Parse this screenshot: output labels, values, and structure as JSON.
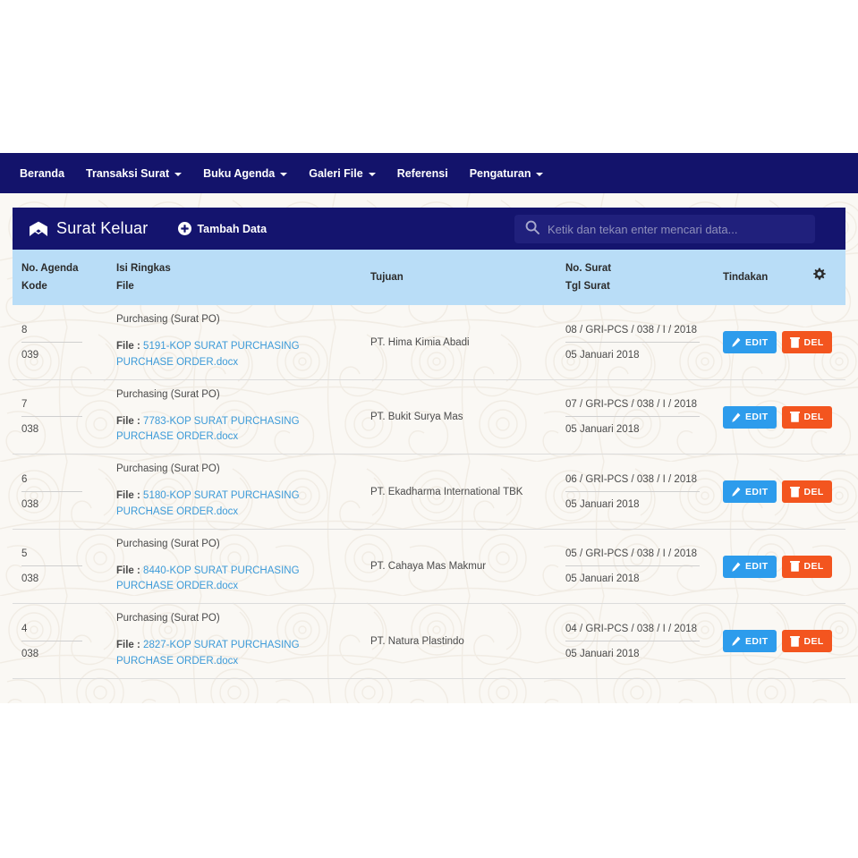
{
  "navbar": {
    "items": [
      {
        "label": "Beranda",
        "caret": false,
        "name": "nav-beranda"
      },
      {
        "label": "Transaksi Surat",
        "caret": true,
        "name": "nav-transaksi-surat"
      },
      {
        "label": "Buku Agenda",
        "caret": true,
        "name": "nav-buku-agenda"
      },
      {
        "label": "Galeri File",
        "caret": true,
        "name": "nav-galeri-file"
      },
      {
        "label": "Referensi",
        "caret": false,
        "name": "nav-referensi"
      },
      {
        "label": "Pengaturan",
        "caret": true,
        "name": "nav-pengaturan"
      }
    ]
  },
  "panel": {
    "title": "Surat Keluar",
    "title_icon": "envelope-icon",
    "add_label": "Tambah Data",
    "add_icon": "plus-circle-icon",
    "search": {
      "icon": "search-icon",
      "placeholder": "Ketik dan tekan enter mencari data...",
      "value": ""
    }
  },
  "table": {
    "headers": {
      "agenda_line1": "No. Agenda",
      "agenda_line2": "Kode",
      "isi_line1": "Isi Ringkas",
      "isi_line2": "File",
      "tujuan": "Tujuan",
      "surat_line1": "No. Surat",
      "surat_line2": "Tgl Surat",
      "tindakan": "Tindakan",
      "gear_icon": "gear-icon"
    },
    "file_label": "File :",
    "actions": {
      "edit": "EDIT",
      "del": "DEL"
    },
    "rows": [
      {
        "no_agenda": "8",
        "kode": "039",
        "isi_ringkas": "Purchasing (Surat PO)",
        "file_name": "5191-KOP SURAT PURCHASING PURCHASE ORDER.docx",
        "tujuan": "PT. Hima Kimia Abadi",
        "no_surat": "08 / GRI-PCS / 038 / I / 2018",
        "tgl_surat": "05 Januari 2018"
      },
      {
        "no_agenda": "7",
        "kode": "038",
        "isi_ringkas": "Purchasing (Surat PO)",
        "file_name": "7783-KOP SURAT PURCHASING PURCHASE ORDER.docx",
        "tujuan": "PT. Bukit Surya Mas",
        "no_surat": "07 / GRI-PCS / 038 / I / 2018",
        "tgl_surat": "05 Januari 2018"
      },
      {
        "no_agenda": "6",
        "kode": "038",
        "isi_ringkas": "Purchasing (Surat PO)",
        "file_name": "5180-KOP SURAT PURCHASING PURCHASE ORDER.docx",
        "tujuan": "PT. Ekadharma International TBK",
        "no_surat": "06 / GRI-PCS / 038 / I / 2018",
        "tgl_surat": "05 Januari 2018"
      },
      {
        "no_agenda": "5",
        "kode": "038",
        "isi_ringkas": "Purchasing (Surat PO)",
        "file_name": "8440-KOP SURAT PURCHASING PURCHASE ORDER.docx",
        "tujuan": "PT. Cahaya Mas Makmur",
        "no_surat": "05 / GRI-PCS / 038 / I / 2018",
        "tgl_surat": "05 Januari 2018"
      },
      {
        "no_agenda": "4",
        "kode": "038",
        "isi_ringkas": "Purchasing (Surat PO)",
        "file_name": "2827-KOP SURAT PURCHASING PURCHASE ORDER.docx",
        "tujuan": "PT. Natura Plastindo",
        "no_surat": "04 / GRI-PCS / 038 / I / 2018",
        "tgl_surat": "05 Januari 2018"
      }
    ]
  },
  "colors": {
    "navbar": "#13136b",
    "panel_header": "#14146e",
    "table_header": "#b9ddf7",
    "link": "#3c9ad8",
    "edit_button": "#2d9cec",
    "del_button": "#f3551f",
    "page_background": "#faf8f4"
  }
}
